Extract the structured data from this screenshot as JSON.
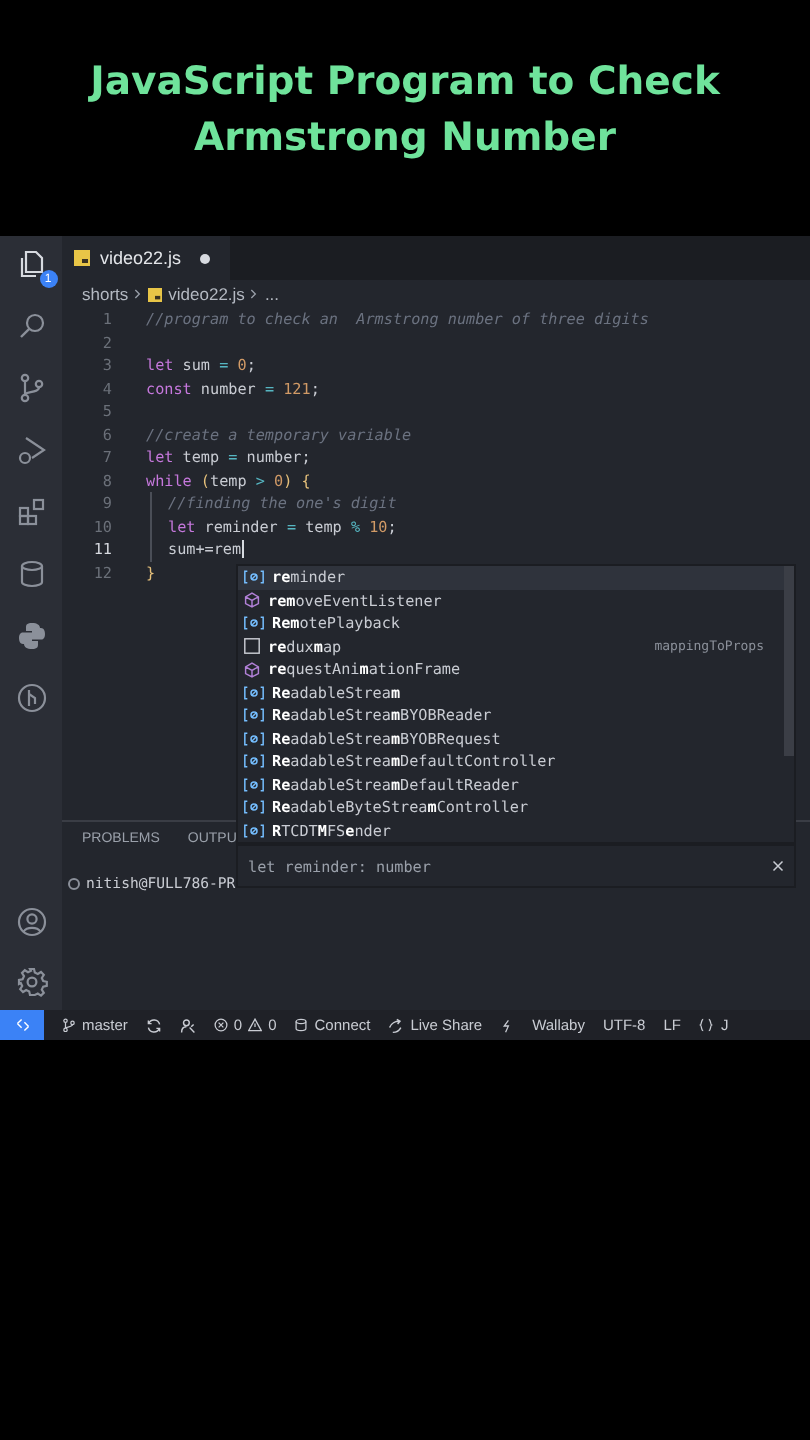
{
  "headline": [
    "JavaScript Program to Check",
    "Armstrong Number"
  ],
  "activity_bar": {
    "explorer_badge": "1"
  },
  "tab": {
    "title": "video22.js",
    "modified": true
  },
  "breadcrumb": [
    "shorts",
    "video22.js",
    "..."
  ],
  "code": [
    {
      "number": "1",
      "current": false,
      "guide": false,
      "tokens": [
        {
          "kind": "comment",
          "text": "//program to check an  Armstrong number of three digits"
        }
      ]
    },
    {
      "number": "2",
      "current": false,
      "guide": false
    },
    {
      "number": "3",
      "current": false,
      "guide": false,
      "tokens": [
        {
          "kind": "keyword",
          "text": "let"
        },
        {
          "kind": "ident",
          "text": " sum "
        },
        {
          "kind": "op",
          "text": "="
        },
        {
          "kind": "number",
          "text": " 0"
        },
        {
          "kind": "ident",
          "text": ";"
        }
      ]
    },
    {
      "number": "4",
      "current": false,
      "guide": false,
      "tokens": [
        {
          "kind": "keyword",
          "text": "const"
        },
        {
          "kind": "ident",
          "text": " number "
        },
        {
          "kind": "op",
          "text": "="
        },
        {
          "kind": "number",
          "text": " 121"
        },
        {
          "kind": "ident",
          "text": ";"
        }
      ]
    },
    {
      "number": "5",
      "current": false,
      "guide": false
    },
    {
      "number": "6",
      "current": false,
      "guide": false,
      "tokens": [
        {
          "kind": "comment",
          "text": "//create a temporary variable"
        }
      ]
    },
    {
      "number": "7",
      "current": false,
      "guide": false,
      "tokens": [
        {
          "kind": "keyword",
          "text": "let"
        },
        {
          "kind": "ident",
          "text": " temp "
        },
        {
          "kind": "op",
          "text": "="
        },
        {
          "kind": "ident",
          "text": " number;"
        }
      ]
    },
    {
      "number": "8",
      "current": false,
      "guide": false,
      "tokens": [
        {
          "kind": "keyword",
          "text": "while"
        },
        {
          "kind": "bracket",
          "text": " ("
        },
        {
          "kind": "ident",
          "text": "temp "
        },
        {
          "kind": "op",
          "text": ">"
        },
        {
          "kind": "number",
          "text": " 0"
        },
        {
          "kind": "bracket",
          "text": ") {"
        }
      ]
    },
    {
      "number": "9",
      "current": false,
      "guide": true,
      "tokens": [
        {
          "kind": "comment",
          "text": "//finding the one's digit"
        }
      ]
    },
    {
      "number": "10",
      "current": false,
      "guide": true,
      "tokens": [
        {
          "kind": "keyword",
          "text": "let"
        },
        {
          "kind": "ident",
          "text": " reminder "
        },
        {
          "kind": "op",
          "text": "="
        },
        {
          "kind": "ident",
          "text": " temp "
        },
        {
          "kind": "op",
          "text": "%"
        },
        {
          "kind": "number",
          "text": " 10"
        },
        {
          "kind": "ident",
          "text": ";"
        }
      ]
    },
    {
      "number": "11",
      "current": true,
      "guide": true,
      "tokens": [
        {
          "kind": "ident",
          "text": "sum+=rem"
        }
      ]
    },
    {
      "number": "12",
      "current": false,
      "guide": false,
      "tokens": [
        {
          "kind": "bracket",
          "text": "}"
        }
      ]
    }
  ],
  "suggestions": [
    {
      "label": "**re**minder",
      "kind": "variable",
      "selected": true
    },
    {
      "label": "**rem**oveEventListener",
      "kind": "method",
      "selected": false
    },
    {
      "label": "**Rem**otePlayback",
      "kind": "variable",
      "selected": false
    },
    {
      "label": "**re**dux**m**ap",
      "kind": "snippet",
      "selected": false,
      "detail": "mappingToProps"
    },
    {
      "label": "**re**questAni**m**ationFrame",
      "kind": "method",
      "selected": false
    },
    {
      "label": "**Re**adableStrea**m**",
      "kind": "variable",
      "selected": false
    },
    {
      "label": "**Re**adableStrea**m**BYOBReader",
      "kind": "variable",
      "selected": false
    },
    {
      "label": "**Re**adableStrea**m**BYOBRequest",
      "kind": "variable",
      "selected": false
    },
    {
      "label": "**Re**adableStrea**m**DefaultController",
      "kind": "variable",
      "selected": false
    },
    {
      "label": "**Re**adableStrea**m**DefaultReader",
      "kind": "variable",
      "selected": false
    },
    {
      "label": "**Re**adableByteStrea**m**Controller",
      "kind": "variable",
      "selected": false
    },
    {
      "label": "**R**TCDT**M**FS**e**nder",
      "kind": "variable",
      "selected": false
    }
  ],
  "suggestion_detail": "let reminder: number",
  "panel": {
    "tabs": [
      "PROBLEMS",
      "OUTPU"
    ],
    "terminal_line": "nitish@FULL786-PR"
  },
  "status_bar": [
    {
      "kind": "remote"
    },
    {
      "kind": "branch",
      "text": "master"
    },
    {
      "kind": "sync"
    },
    {
      "kind": "person"
    },
    {
      "kind": "problems",
      "errors": "0",
      "warnings": "0"
    },
    {
      "kind": "database",
      "text": "Connect"
    },
    {
      "kind": "share",
      "text": "Live Share"
    },
    {
      "kind": "flask"
    },
    {
      "kind": "plain",
      "text": "Wallaby"
    },
    {
      "kind": "plain",
      "text": "UTF-8"
    },
    {
      "kind": "plain",
      "text": "LF"
    },
    {
      "kind": "braces",
      "text": "J"
    }
  ]
}
